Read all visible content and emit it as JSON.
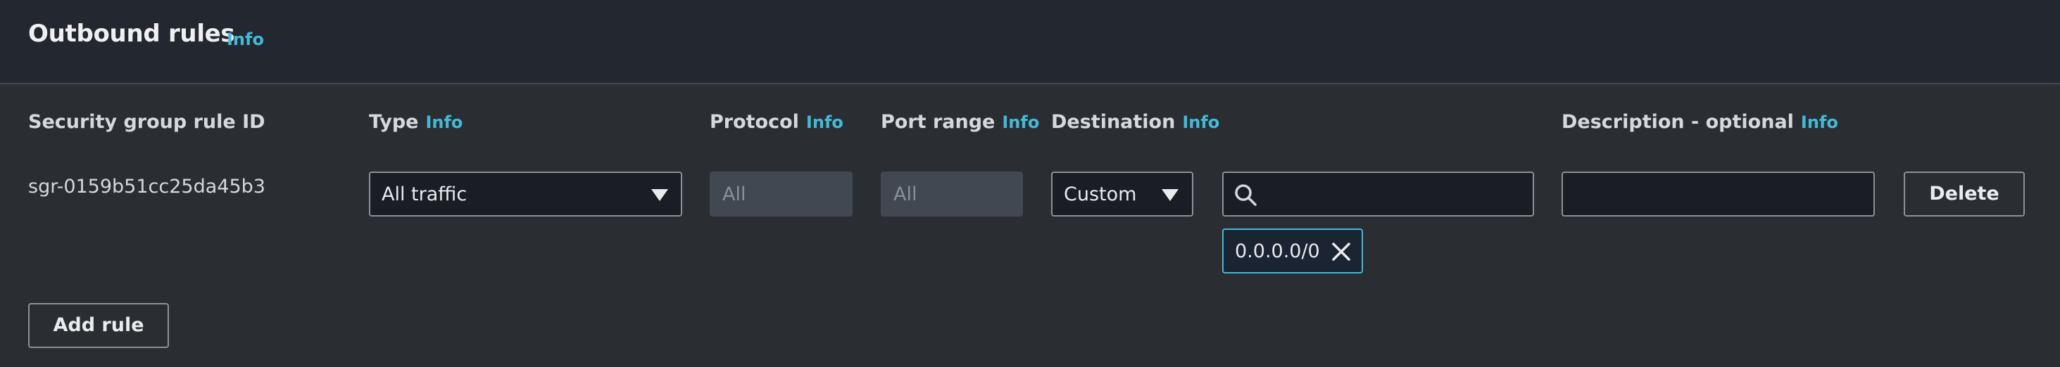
{
  "section": {
    "title": "Outbound rules",
    "info_label": "Info"
  },
  "columns": {
    "rule_id": {
      "label": "Security group rule ID"
    },
    "type": {
      "label": "Type",
      "info": "Info"
    },
    "protocol": {
      "label": "Protocol",
      "info": "Info"
    },
    "port_range": {
      "label": "Port range",
      "info": "Info"
    },
    "destination": {
      "label": "Destination",
      "info": "Info"
    },
    "description": {
      "label": "Description - optional",
      "info": "Info"
    }
  },
  "rule": {
    "id": "sgr-0159b51cc25da45b3",
    "type_value": "All traffic",
    "protocol_value": "All",
    "port_range_value": "All",
    "destination_type": "Custom",
    "destination_search": "",
    "destination_token": "0.0.0.0/0",
    "description_value": "",
    "delete_label": "Delete"
  },
  "actions": {
    "add_rule_label": "Add rule"
  },
  "icons": {
    "caret": "caret-down-icon",
    "search": "search-icon",
    "remove": "close-icon"
  },
  "colors": {
    "background": "#2a2e33",
    "header_background": "#232830",
    "info_link": "#44b9d6",
    "input_border": "#8d9096",
    "token_border": "#44b9d6"
  }
}
